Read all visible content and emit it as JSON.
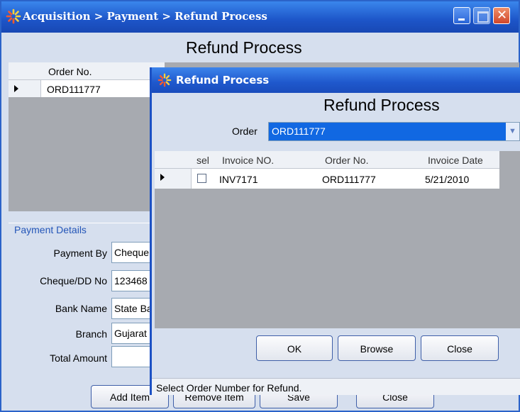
{
  "main": {
    "title": "Acquisition > Payment > Refund Process",
    "heading": "Refund Process",
    "grid": {
      "header": "Order No.",
      "rows": [
        "ORD111777"
      ]
    },
    "payment_details": {
      "legend": "Payment Details",
      "fields": [
        {
          "label": "Payment By",
          "value": "Cheque"
        },
        {
          "label": "Cheque/DD No",
          "value": "123468"
        },
        {
          "label": "Bank Name",
          "value": "State Bank"
        },
        {
          "label": "Branch",
          "value": "Gujarat"
        },
        {
          "label": "Total Amount",
          "value": ""
        }
      ]
    },
    "buttons": [
      "Add Item",
      "Remove Item",
      "Save",
      "Close"
    ]
  },
  "dialog": {
    "title": "Refund Process",
    "heading": "Refund Process",
    "order_label": "Order",
    "order_value": "ORD111777",
    "grid": {
      "columns": [
        "sel",
        "Invoice NO.",
        "Order No.",
        "Invoice Date"
      ],
      "rows": [
        {
          "sel": false,
          "invoice_no": "INV7171",
          "order_no": "ORD111777",
          "invoice_date": "5/21/2010"
        }
      ]
    },
    "buttons": {
      "ok": "OK",
      "browse": "Browse",
      "close": "Close"
    },
    "status": "Select Order Number for Refund."
  }
}
